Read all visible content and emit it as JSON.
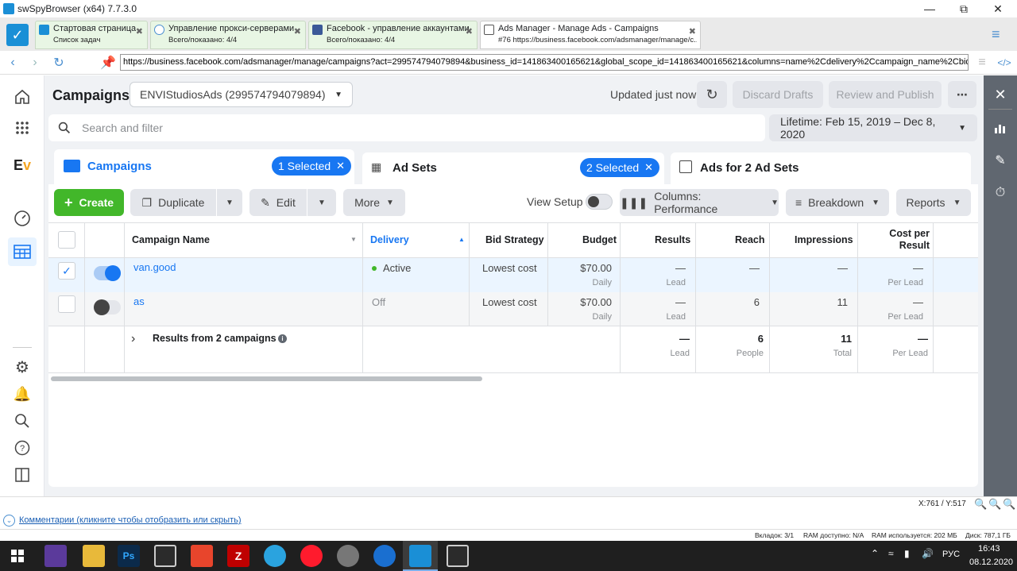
{
  "window": {
    "title": "swSpyBrowser (x64) 7.7.3.0"
  },
  "browser_tabs": [
    {
      "title": "Стартовая страница",
      "subtitle": "Список задач"
    },
    {
      "title": "Управление прокси-серверами",
      "subtitle": "Всего/показано: 4/4"
    },
    {
      "title": "Facebook - управление аккаунтами",
      "subtitle": "Всего/показано: 4/4"
    },
    {
      "title": "Ads Manager - Manage Ads - Campaigns",
      "subtitle": "#76 https://business.facebook.com/adsmanager/manage/c..."
    }
  ],
  "url": "https://business.facebook.com/adsmanager/manage/campaigns?act=299574794079894&business_id=141863400165621&global_scope_id=141863400165621&columns=name%2Cdelivery%2Ccampaign_name%2Cbid%2Cbudget%2",
  "header": {
    "title": "Campaigns",
    "account": "ENVIStudiosAds (299574794079894)",
    "updated": "Updated just now",
    "discard": "Discard Drafts",
    "review": "Review and Publish",
    "more": "⋯"
  },
  "search": {
    "placeholder": "Search and filter",
    "date_range": "Lifetime: Feb 15, 2019 – Dec 8, 2020"
  },
  "level_tabs": [
    {
      "label": "Campaigns",
      "selected": "1 Selected"
    },
    {
      "label": "Ad Sets",
      "selected": "2 Selected"
    },
    {
      "label": "Ads for 2 Ad Sets"
    }
  ],
  "toolbar": {
    "create": "Create",
    "duplicate": "Duplicate",
    "edit": "Edit",
    "more": "More",
    "view_setup": "View Setup",
    "columns": "Columns: Performance",
    "breakdown": "Breakdown",
    "reports": "Reports"
  },
  "table": {
    "headers": [
      "Campaign Name",
      "Delivery",
      "Bid Strategy",
      "Budget",
      "Results",
      "Reach",
      "Impressions",
      "Cost per Result"
    ],
    "rows": [
      {
        "name": "van.good",
        "delivery": "Active",
        "bid": "Lowest cost",
        "budget": "$70.00",
        "budget_sub": "Daily",
        "results": "—",
        "results_sub": "Lead",
        "reach": "—",
        "impressions": "—",
        "cpr": "—",
        "cpr_sub": "Per Lead"
      },
      {
        "name": "as",
        "delivery": "Off",
        "bid": "Lowest cost",
        "budget": "$70.00",
        "budget_sub": "Daily",
        "results": "—",
        "results_sub": "Lead",
        "reach": "6",
        "impressions": "11",
        "cpr": "—",
        "cpr_sub": "Per Lead"
      }
    ],
    "summary": {
      "label": "Results from 2 campaigns",
      "results": "—",
      "results_sub": "Lead",
      "reach": "6",
      "reach_sub": "People",
      "impressions": "11",
      "impressions_sub": "Total",
      "cpr": "—",
      "cpr_sub": "Per Lead"
    }
  },
  "status": {
    "coords": "X:761 / Y:517",
    "comments": "Комментарии (кликните чтобы отобразить или скрыть)",
    "tabs": "Вкладок: 3/1",
    "ram_free": "RAM доступно: N/A",
    "ram_used": "RAM используется: 202 МБ",
    "disk": "Диск: 787,1 ГБ"
  },
  "taskbar": {
    "lang": "РУС",
    "time": "16:43",
    "date": "08.12.2020"
  },
  "colors": {
    "accent": "#1877f2",
    "create": "#42b72a",
    "tab_green": "#e8f6e4"
  }
}
